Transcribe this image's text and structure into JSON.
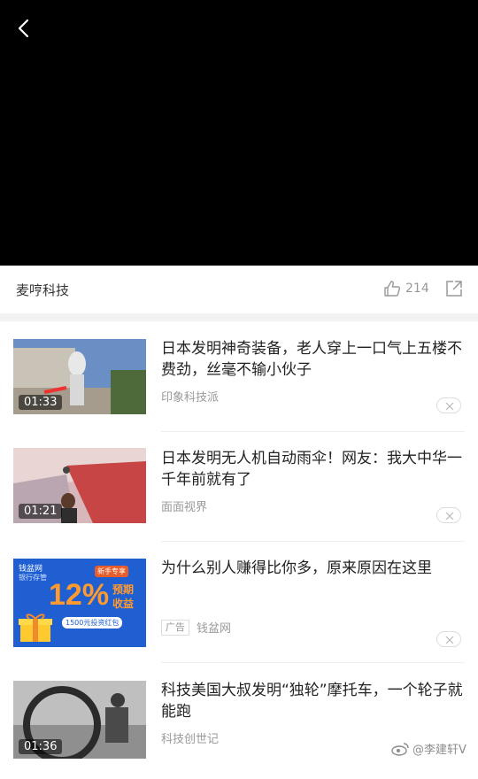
{
  "author": {
    "name": "麦哼科技",
    "likes": "214"
  },
  "feed": [
    {
      "title": "日本发明神奇装备，老人穿上一口气上五楼不费劲，丝毫不输小伙子",
      "source": "印象科技派",
      "duration": "01:33"
    },
    {
      "title": "日本发明无人机自动雨伞！网友：我大中华一千年前就有了",
      "source": "面面视界",
      "duration": "01:21"
    },
    {
      "title": "为什么别人赚得比你多，原来原因在这里",
      "ad_label": "广告",
      "source": "钱盆网",
      "ad_thumb": {
        "brand": "钱盆网",
        "tagline": "银行存管",
        "pct": "12%",
        "badge": "新手专享",
        "sub1": "预期",
        "sub2": "收益",
        "coupon": "1500元投资红包"
      }
    },
    {
      "title": "科技美国大叔发明“独轮”摩托车，一个轮子就能跑",
      "source": "科技创世记",
      "duration": "01:36"
    }
  ],
  "watermark": "@李建轩V"
}
